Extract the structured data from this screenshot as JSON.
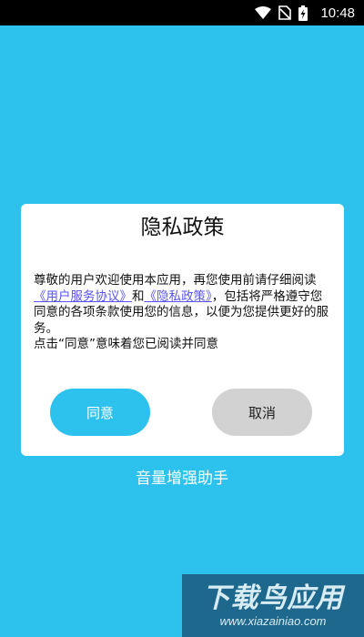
{
  "status_bar": {
    "time": "10:48",
    "icons": [
      "wifi-icon",
      "sim-no-signal-icon",
      "battery-charging-icon"
    ]
  },
  "dialog": {
    "title": "隐私政策",
    "text_1": "尊敬的用户欢迎使用本应用，再您使用前请仔细阅读",
    "link_user_agreement": "《用户服务协议》",
    "text_and": "和",
    "link_privacy_policy": "《隐私政策》",
    "text_2": "，包括将严格遵守您同意的各项条款使用您的信息，以便为您提供更好的服务。",
    "text_3": "点击“同意”意味着您已阅读并同意",
    "agree_label": "同意",
    "cancel_label": "取消"
  },
  "app_name": "音量增强助手",
  "watermark": {
    "main": "下载鸟应用",
    "sub": "www.xiazainiao.com"
  },
  "colors": {
    "background": "#2dc2ee",
    "agree_button": "#2dc2ee",
    "cancel_button": "#d2d2d2",
    "link": "#5a54f5"
  }
}
